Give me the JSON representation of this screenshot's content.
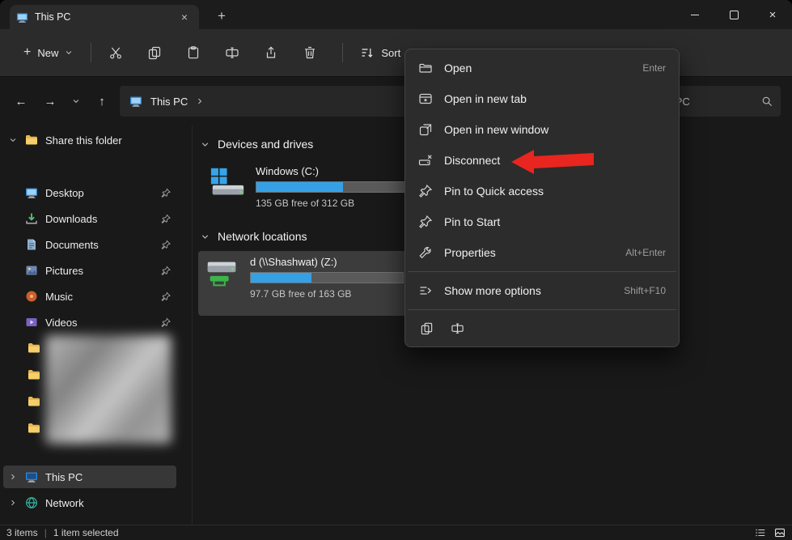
{
  "window": {
    "tab_title": "This PC"
  },
  "toolbar": {
    "new_label": "New",
    "sort_label": "Sort"
  },
  "addressbar": {
    "breadcrumb_root": "This PC",
    "search_value": "Search This PC"
  },
  "sidebar": {
    "items": [
      {
        "label": "Share this folder",
        "icon": "folder-icon",
        "expanded": true
      },
      {
        "label": "Desktop",
        "icon": "desktop-icon",
        "pinned": true
      },
      {
        "label": "Downloads",
        "icon": "downloads-icon",
        "pinned": true
      },
      {
        "label": "Documents",
        "icon": "documents-icon",
        "pinned": true
      },
      {
        "label": "Pictures",
        "icon": "pictures-icon",
        "pinned": true
      },
      {
        "label": "Music",
        "icon": "music-icon",
        "pinned": true
      },
      {
        "label": "Videos",
        "icon": "videos-icon",
        "pinned": true
      },
      {
        "label": "This PC",
        "icon": "this-pc-icon",
        "selected": true
      },
      {
        "label": "Network",
        "icon": "network-icon"
      }
    ]
  },
  "content": {
    "sections": [
      {
        "title": "Devices and drives",
        "drives": [
          {
            "name": "Windows (C:)",
            "free_text": "135 GB free of 312 GB",
            "used_percent": 57,
            "icon": "windows-drive-icon"
          }
        ]
      },
      {
        "title": "Network locations",
        "drives": [
          {
            "name": "d (\\\\Shashwat) (Z:)",
            "free_text": "97.7 GB free of 163 GB",
            "used_percent": 40,
            "icon": "network-drive-icon",
            "selected": true
          }
        ]
      }
    ]
  },
  "context_menu": {
    "items": [
      {
        "label": "Open",
        "shortcut": "Enter",
        "icon": "open-icon"
      },
      {
        "label": "Open in new tab",
        "shortcut": "",
        "icon": "new-tab-icon"
      },
      {
        "label": "Open in new window",
        "shortcut": "",
        "icon": "new-window-icon"
      },
      {
        "label": "Disconnect",
        "shortcut": "",
        "icon": "disconnect-icon"
      },
      {
        "label": "Pin to Quick access",
        "shortcut": "",
        "icon": "pin-icon"
      },
      {
        "label": "Pin to Start",
        "shortcut": "",
        "icon": "pin-icon"
      },
      {
        "label": "Properties",
        "shortcut": "Alt+Enter",
        "icon": "properties-icon"
      },
      {
        "label": "Show more options",
        "shortcut": "Shift+F10",
        "icon": "show-more-icon"
      }
    ]
  },
  "statusbar": {
    "items_count": "3 items",
    "selection": "1 item selected"
  },
  "icons": {
    "close": "×",
    "plus": "+",
    "back-arrow": "←",
    "forward-arrow": "→",
    "up-arrow": "↑",
    "divider": "|",
    "search": "svg-magnifier",
    "pin": "svg-pushpin"
  },
  "colors": {
    "accent-blue": "#36a0e4",
    "arrow-red": "#e8251f"
  }
}
